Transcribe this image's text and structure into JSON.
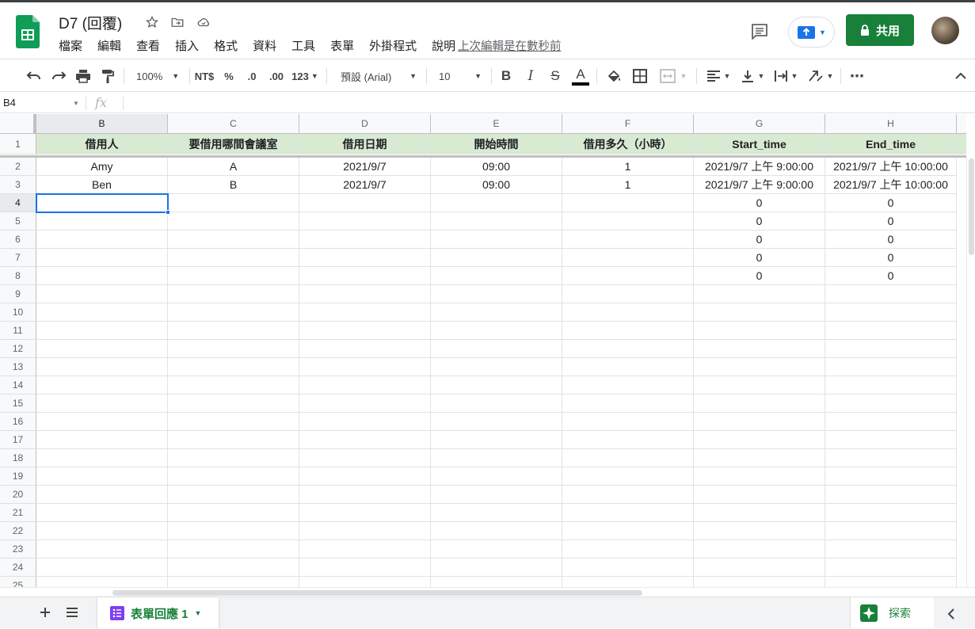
{
  "app": {
    "doc_title": "D7 (回覆)",
    "last_edit": "上次編輯是在數秒前",
    "share_label": "共用",
    "brand_color": "#188038"
  },
  "menu": [
    "檔案",
    "編輯",
    "查看",
    "插入",
    "格式",
    "資料",
    "工具",
    "表單",
    "外掛程式",
    "說明"
  ],
  "toolbar": {
    "zoom": "100%",
    "currency": "NT$",
    "percent": "%",
    "dec_decrease": ".0",
    "dec_increase": ".00",
    "more_formats": "123",
    "font": "預設 (Arial)",
    "font_size": "10",
    "bold": "B",
    "italic": "I",
    "strike": "S",
    "text_color": "A",
    "more": "⋯"
  },
  "formula": {
    "name_box": "B4",
    "fx": "fx",
    "value": ""
  },
  "sheet": {
    "columns": [
      "B",
      "C",
      "D",
      "E",
      "F",
      "G",
      "H"
    ],
    "row_numbers": [
      1,
      2,
      3,
      4,
      5,
      6,
      7,
      8,
      9,
      10,
      11,
      12,
      13,
      14,
      15,
      16,
      17,
      18,
      19,
      20,
      21,
      22,
      23,
      24,
      25
    ],
    "header_row": [
      "借用人",
      "要借用哪間會議室",
      "借用日期",
      "開始時間",
      "借用多久（小時）",
      "Start_time",
      "End_time"
    ],
    "rows": [
      [
        "Amy",
        "A",
        "2021/9/7",
        "09:00",
        "1",
        "2021/9/7 上午 9:00:00",
        "2021/9/7 上午 10:00:00"
      ],
      [
        "Ben",
        "B",
        "2021/9/7",
        "09:00",
        "1",
        "2021/9/7 上午 9:00:00",
        "2021/9/7 上午 10:00:00"
      ],
      [
        "",
        "",
        "",
        "",
        "",
        "0",
        "0"
      ],
      [
        "",
        "",
        "",
        "",
        "",
        "0",
        "0"
      ],
      [
        "",
        "",
        "",
        "",
        "",
        "0",
        "0"
      ],
      [
        "",
        "",
        "",
        "",
        "",
        "0",
        "0"
      ],
      [
        "",
        "",
        "",
        "",
        "",
        "0",
        "0"
      ]
    ],
    "selected_cell": "B4",
    "header_fill": "#d9ead3"
  },
  "bottom": {
    "tab_label": "表單回應 1",
    "explore_label": "探索"
  }
}
